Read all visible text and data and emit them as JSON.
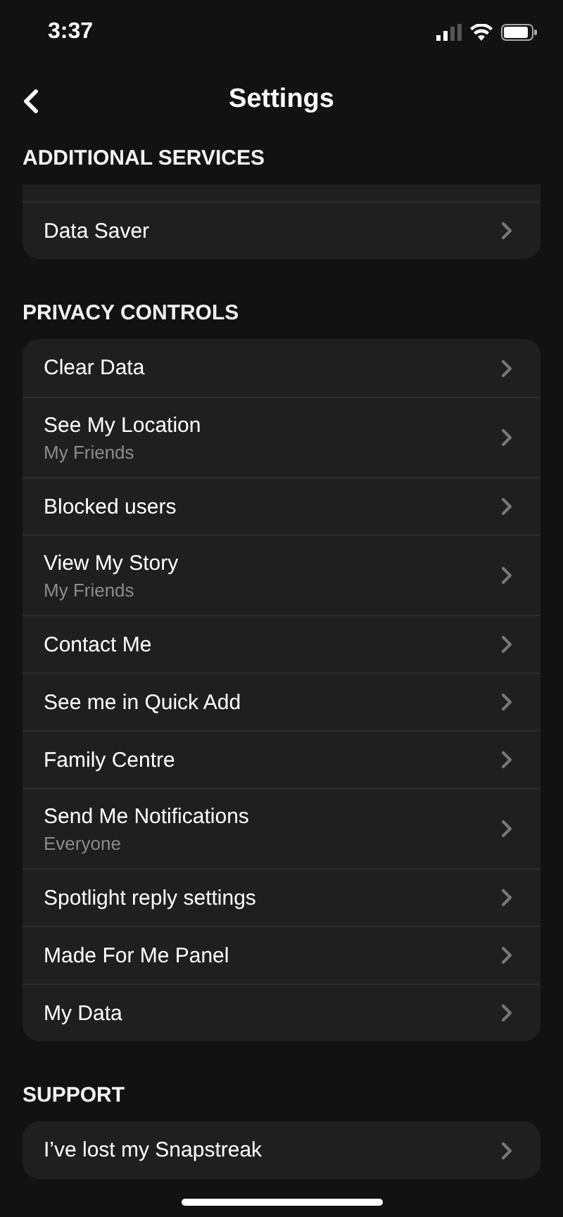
{
  "status_bar": {
    "time": "3:37"
  },
  "nav": {
    "title": "Settings"
  },
  "sections": [
    {
      "title": "ADDITIONAL SERVICES",
      "cut_top": true,
      "items": [
        {
          "label": "Data Saver"
        }
      ]
    },
    {
      "title": "PRIVACY CONTROLS",
      "cut_top": false,
      "items": [
        {
          "label": "Clear Data"
        },
        {
          "label": "See My Location",
          "sublabel": "My Friends"
        },
        {
          "label": "Blocked users"
        },
        {
          "label": "View My Story",
          "sublabel": "My Friends"
        },
        {
          "label": "Contact Me"
        },
        {
          "label": "See me in Quick Add"
        },
        {
          "label": "Family Centre"
        },
        {
          "label": "Send Me Notifications",
          "sublabel": "Everyone"
        },
        {
          "label": "Spotlight reply settings"
        },
        {
          "label": "Made For Me Panel"
        },
        {
          "label": "My Data"
        }
      ]
    },
    {
      "title": "SUPPORT",
      "cut_top": false,
      "items": [
        {
          "label": "I’ve lost my Snapstreak"
        }
      ]
    }
  ]
}
